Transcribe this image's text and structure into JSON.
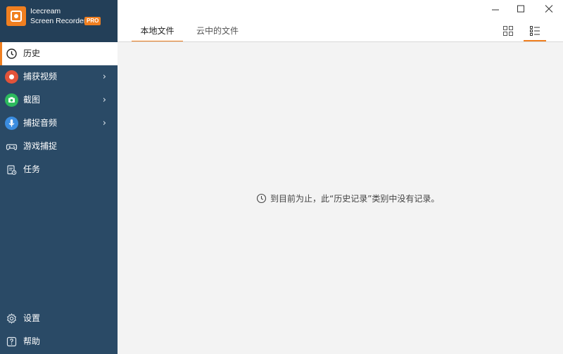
{
  "brand": {
    "line1": "Icecream",
    "line2": "Screen Recorder",
    "badge": "PRO"
  },
  "tabs": [
    {
      "label": "本地文件",
      "active": true
    },
    {
      "label": "云中的文件",
      "active": false
    }
  ],
  "nav": [
    {
      "label": "历史",
      "icon": "clock-icon",
      "active": true
    },
    {
      "label": "捕获视频",
      "icon": "record-icon",
      "arrow": "›"
    },
    {
      "label": "截图",
      "icon": "camera-icon",
      "arrow": "›"
    },
    {
      "label": "捕捉音频",
      "icon": "microphone-icon",
      "arrow": "›"
    },
    {
      "label": "游戏捕捉",
      "icon": "gamepad-icon"
    },
    {
      "label": "任务",
      "icon": "tasks-icon"
    }
  ],
  "bottom_nav": [
    {
      "label": "设置",
      "icon": "gear-icon"
    },
    {
      "label": "帮助",
      "icon": "help-icon"
    }
  ],
  "empty_message": "到目前为止，此“历史记录”类别中没有记录。",
  "colors": {
    "accent": "#f07f20",
    "sidebar": "#2a4a66",
    "brand_bg": "#233f58"
  }
}
